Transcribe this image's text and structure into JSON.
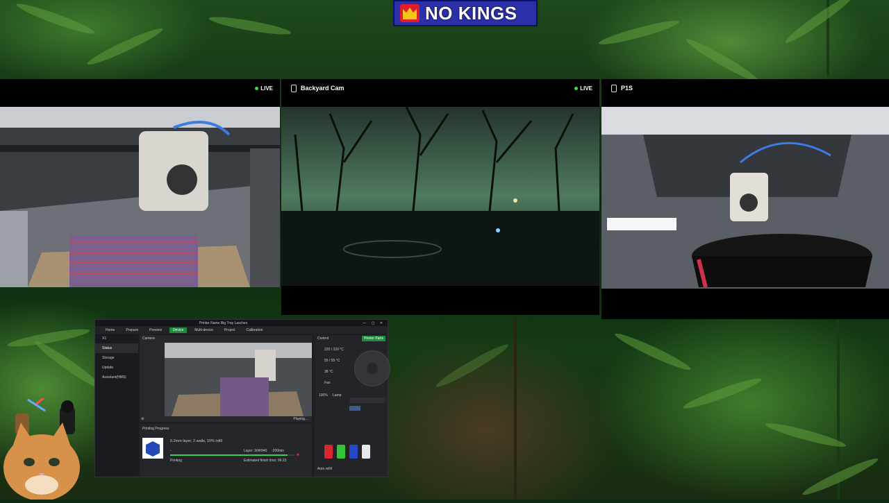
{
  "banner": {
    "text": "NO KINGS"
  },
  "cameras": [
    {
      "title": "",
      "live": "LIVE"
    },
    {
      "title": "Backyard Cam",
      "live": "LIVE"
    },
    {
      "title": "P1S",
      "live": ""
    }
  ],
  "app": {
    "tabs": [
      "Home",
      "Prepare",
      "Preview",
      "Device",
      "Multi-device",
      "Project",
      "Calibration"
    ],
    "window_title": "Printer Name Big Tray Lasches",
    "sidebar": [
      "X1",
      "Status",
      "Storage",
      "Update",
      "Assistant(HMS)"
    ],
    "control_label": "Control",
    "printer_parts_button": "Printer Parts",
    "camera_label": "Camera",
    "playing": "Playing...",
    "progress_header": "Printing Progress",
    "job_name": "0.2mm layer, 2 walls, 10% infill",
    "layer": "Layer: 304/940",
    "time_left": "-200min",
    "percent": "-",
    "status": "Printing",
    "estimated": "Estimated finish time: 06:23",
    "temps": [
      "220 / 220 °C",
      "55 / 55 °C",
      "38 °C"
    ],
    "fan_label": "Fan",
    "speed_label": "100%",
    "lamp_label": "Lamp",
    "auto_refill": "Auto refill",
    "spools": [
      {
        "label": "PLA",
        "color": "#d7262e"
      },
      {
        "label": "PLA",
        "color": "#33c43a"
      },
      {
        "label": "PLA",
        "color": "#2747c9"
      },
      {
        "label": "PLA",
        "color": "#e8e8e8"
      }
    ]
  }
}
